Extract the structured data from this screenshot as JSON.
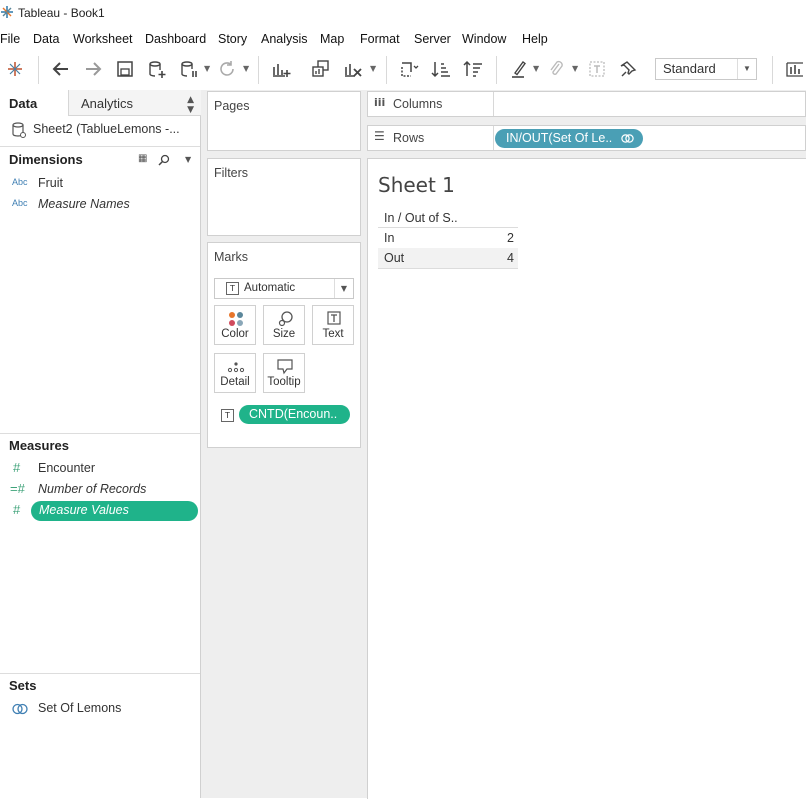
{
  "window": {
    "title": "Tableau - Book1"
  },
  "menu": [
    "File",
    "Data",
    "Worksheet",
    "Dashboard",
    "Story",
    "Analysis",
    "Map",
    "Format",
    "Server",
    "Window",
    "Help"
  ],
  "toolbar": {
    "fit_mode": "Standard"
  },
  "left_pane": {
    "tabs": {
      "data": "Data",
      "analytics": "Analytics"
    },
    "datasource": "Sheet2 (TablueLemons -...",
    "dimensions": {
      "header": "Dimensions",
      "items": [
        {
          "type_label": "Abc",
          "label": "Fruit"
        },
        {
          "type_label": "Abc",
          "label": "Measure Names"
        }
      ]
    },
    "measures": {
      "header": "Measures",
      "items": [
        {
          "label": "Encounter"
        },
        {
          "label": "Number of Records"
        },
        {
          "label": "Measure Values"
        }
      ]
    },
    "sets": {
      "header": "Sets",
      "items": [
        {
          "label": "Set Of Lemons"
        }
      ]
    }
  },
  "cards": {
    "pages": "Pages",
    "filters": "Filters",
    "marks": {
      "header": "Marks",
      "mark_type": "Automatic",
      "buttons": {
        "color": "Color",
        "size": "Size",
        "text": "Text",
        "detail": "Detail",
        "tooltip": "Tooltip"
      },
      "field_pill": "CNTD(Encoun.."
    }
  },
  "shelves": {
    "columns": "Columns",
    "rows": "Rows",
    "rows_pill": "IN/OUT(Set Of Le.."
  },
  "viz": {
    "sheet_title": "Sheet 1",
    "table": {
      "header": "In / Out of S..",
      "rows": [
        {
          "label": "In",
          "value": "2"
        },
        {
          "label": "Out",
          "value": "4"
        }
      ]
    }
  },
  "colors": {
    "pill_green": "#1fb38a",
    "pill_blue": "#4a9fb5",
    "panel_bg": "#eeeeee"
  }
}
